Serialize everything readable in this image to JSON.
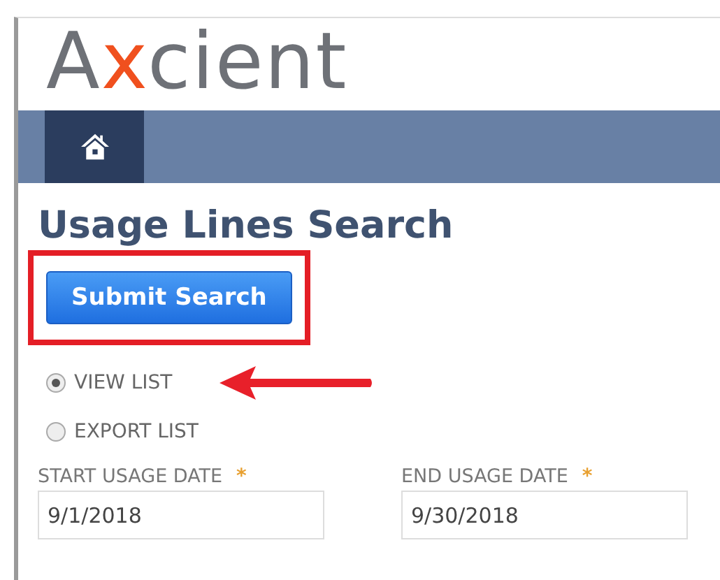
{
  "logo": {
    "parts": [
      {
        "text": "A",
        "accent": false
      },
      {
        "text": "x",
        "accent": true
      },
      {
        "text": "cient",
        "accent": false
      }
    ]
  },
  "nav": {
    "home_selected": true
  },
  "title": "Usage Lines Search",
  "submit_button": {
    "label": "Submit Search",
    "highlighted": true
  },
  "output_options": [
    {
      "label": "VIEW LIST",
      "selected": true,
      "pointed_at": true
    },
    {
      "label": "EXPORT LIST",
      "selected": false,
      "pointed_at": false
    }
  ],
  "fields": [
    {
      "label": "START USAGE DATE",
      "required_mark": "*",
      "value": "9/1/2018"
    },
    {
      "label": "END USAGE DATE",
      "required_mark": "*",
      "value": "9/30/2018"
    }
  ]
}
